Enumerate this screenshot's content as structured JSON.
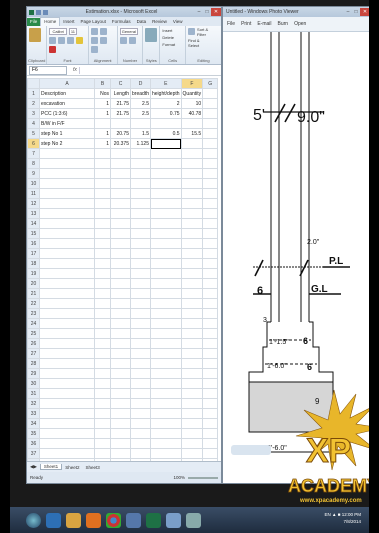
{
  "excel": {
    "title": "Estimation.xlsx - Microsoft Excel",
    "tabs": [
      "File",
      "Home",
      "Insert",
      "Page Layout",
      "Formulas",
      "Data",
      "Review",
      "View"
    ],
    "ribbon_groups": [
      "Clipboard",
      "Font",
      "Alignment",
      "Number",
      "Styles",
      "Cells",
      "Editing"
    ],
    "ribbon": {
      "font_name": "Calibri",
      "font_size": "11",
      "number_format": "General",
      "insert": "Insert",
      "delete": "Delete",
      "format": "Format",
      "sort_filter": "Sort & Filter",
      "find_select": "Find & Select"
    },
    "name_box": "F6",
    "fx": "fx",
    "columns": [
      "A",
      "B",
      "C",
      "D",
      "E",
      "F",
      "G"
    ],
    "rows": [
      {
        "n": "1",
        "cells": [
          "Description",
          "Nos",
          "Length",
          "breadth",
          "height/depth",
          "Quantity"
        ]
      },
      {
        "n": "2",
        "cells": [
          "excavation",
          "1",
          "21.75",
          "2.5",
          "2",
          "10"
        ]
      },
      {
        "n": "3",
        "cells": [
          "PCC (1:3:6)",
          "1",
          "21.75",
          "2.5",
          "0.75",
          "40.78"
        ]
      },
      {
        "n": "4",
        "cells": [
          "B/W in F/F",
          "",
          "",
          "",
          "",
          ""
        ]
      },
      {
        "n": "5",
        "cells": [
          "step No 1",
          "1",
          "20.75",
          "1.5",
          "0.5",
          "15.5"
        ]
      },
      {
        "n": "6",
        "cells": [
          "step No 2",
          "1",
          "20.375",
          "1.125",
          "",
          ""
        ]
      },
      {
        "n": "7",
        "cells": [
          "",
          "",
          "",
          "",
          "",
          ""
        ]
      },
      {
        "n": "8",
        "cells": [
          "",
          "",
          "",
          "",
          "",
          ""
        ]
      },
      {
        "n": "9",
        "cells": [
          "",
          "",
          "",
          "",
          "",
          ""
        ]
      },
      {
        "n": "10",
        "cells": [
          "",
          "",
          "",
          "",
          "",
          ""
        ]
      },
      {
        "n": "11",
        "cells": [
          "",
          "",
          "",
          "",
          "",
          ""
        ]
      },
      {
        "n": "12",
        "cells": [
          "",
          "",
          "",
          "",
          "",
          ""
        ]
      },
      {
        "n": "13",
        "cells": [
          "",
          "",
          "",
          "",
          "",
          ""
        ]
      },
      {
        "n": "14",
        "cells": [
          "",
          "",
          "",
          "",
          "",
          ""
        ]
      },
      {
        "n": "15",
        "cells": [
          "",
          "",
          "",
          "",
          "",
          ""
        ]
      },
      {
        "n": "16",
        "cells": [
          "",
          "",
          "",
          "",
          "",
          ""
        ]
      },
      {
        "n": "17",
        "cells": [
          "",
          "",
          "",
          "",
          "",
          ""
        ]
      },
      {
        "n": "18",
        "cells": [
          "",
          "",
          "",
          "",
          "",
          ""
        ]
      },
      {
        "n": "19",
        "cells": [
          "",
          "",
          "",
          "",
          "",
          ""
        ]
      },
      {
        "n": "20",
        "cells": [
          "",
          "",
          "",
          "",
          "",
          ""
        ]
      },
      {
        "n": "21",
        "cells": [
          "",
          "",
          "",
          "",
          "",
          ""
        ]
      },
      {
        "n": "22",
        "cells": [
          "",
          "",
          "",
          "",
          "",
          ""
        ]
      },
      {
        "n": "23",
        "cells": [
          "",
          "",
          "",
          "",
          "",
          ""
        ]
      },
      {
        "n": "24",
        "cells": [
          "",
          "",
          "",
          "",
          "",
          ""
        ]
      },
      {
        "n": "25",
        "cells": [
          "",
          "",
          "",
          "",
          "",
          ""
        ]
      },
      {
        "n": "26",
        "cells": [
          "",
          "",
          "",
          "",
          "",
          ""
        ]
      },
      {
        "n": "27",
        "cells": [
          "",
          "",
          "",
          "",
          "",
          ""
        ]
      },
      {
        "n": "28",
        "cells": [
          "",
          "",
          "",
          "",
          "",
          ""
        ]
      },
      {
        "n": "29",
        "cells": [
          "",
          "",
          "",
          "",
          "",
          ""
        ]
      },
      {
        "n": "30",
        "cells": [
          "",
          "",
          "",
          "",
          "",
          ""
        ]
      },
      {
        "n": "31",
        "cells": [
          "",
          "",
          "",
          "",
          "",
          ""
        ]
      },
      {
        "n": "32",
        "cells": [
          "",
          "",
          "",
          "",
          "",
          ""
        ]
      },
      {
        "n": "33",
        "cells": [
          "",
          "",
          "",
          "",
          "",
          ""
        ]
      },
      {
        "n": "34",
        "cells": [
          "",
          "",
          "",
          "",
          "",
          ""
        ]
      },
      {
        "n": "35",
        "cells": [
          "",
          "",
          "",
          "",
          "",
          ""
        ]
      },
      {
        "n": "36",
        "cells": [
          "",
          "",
          "",
          "",
          "",
          ""
        ]
      },
      {
        "n": "37",
        "cells": [
          "",
          "",
          "",
          "",
          "",
          ""
        ]
      },
      {
        "n": "38",
        "cells": [
          "",
          "",
          "",
          "",
          "",
          ""
        ]
      },
      {
        "n": "39",
        "cells": [
          "",
          "",
          "",
          "",
          "",
          ""
        ]
      },
      {
        "n": "40",
        "cells": [
          "",
          "",
          "",
          "",
          "",
          ""
        ]
      },
      {
        "n": "41",
        "cells": [
          "",
          "",
          "",
          "",
          "",
          ""
        ]
      },
      {
        "n": "42",
        "cells": [
          "",
          "",
          "",
          "",
          "",
          ""
        ]
      },
      {
        "n": "43",
        "cells": [
          "",
          "",
          "",
          "",
          "",
          ""
        ]
      }
    ],
    "selected_cell": "F6",
    "sheet_tabs": [
      "Sheet1",
      "Sheet2",
      "Sheet3"
    ],
    "status_left": "Ready",
    "zoom": "100%"
  },
  "paint": {
    "title": "Untitled - Windows Photo Viewer",
    "menu": [
      "File",
      "Print",
      "E-mail",
      "Burn",
      "Open"
    ],
    "drawing": {
      "dim_top_left": "5'",
      "dim_top_right": "9.0\"",
      "dim_plinth": "2.0\"",
      "label_pl": "P.L",
      "label_gl": "G.L",
      "num_left": "6",
      "num_right": "6",
      "num_step_left": "3",
      "step1": "1'-1.5\"",
      "step1_right": "6",
      "step2": "1'-6.0\"",
      "step2_right": "6",
      "pcc_left": "9",
      "base": "2'-6.0\""
    }
  },
  "watermark": {
    "name": "ACADEMY",
    "brand": "XP",
    "url": "www.xpacademy.com"
  },
  "taskbar": {
    "time": "12:00 PM",
    "date": "7/8/2014",
    "tray_label": "EN"
  },
  "colors": {
    "excel_green": "#1e7145",
    "title_blue": "#b6c8dc",
    "taskbar": "#2b3a4f",
    "logo_gold": "#e8b62a"
  }
}
